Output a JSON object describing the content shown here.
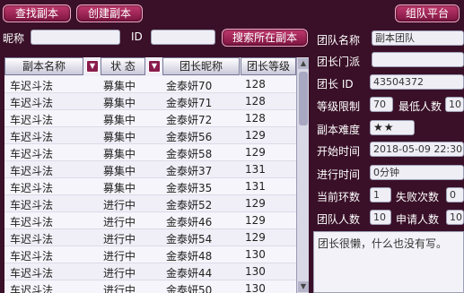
{
  "top_buttons": {
    "search_dungeon": "查找副本",
    "create_dungeon": "创建副本",
    "team_platform": "组队平台"
  },
  "search": {
    "nickname_label": "昵称",
    "nickname_value": "",
    "id_label": "ID",
    "id_value": "",
    "search_button": "搜索所在副本"
  },
  "table": {
    "headers": [
      "副本名称",
      "状 态",
      "团长昵称",
      "团长等级"
    ],
    "rows": [
      [
        "车迟斗法",
        "募集中",
        "金泰妍70",
        "128"
      ],
      [
        "车迟斗法",
        "募集中",
        "金泰妍71",
        "128"
      ],
      [
        "车迟斗法",
        "募集中",
        "金泰妍72",
        "128"
      ],
      [
        "车迟斗法",
        "募集中",
        "金泰妍56",
        "129"
      ],
      [
        "车迟斗法",
        "募集中",
        "金泰妍58",
        "129"
      ],
      [
        "车迟斗法",
        "募集中",
        "金泰妍37",
        "131"
      ],
      [
        "车迟斗法",
        "募集中",
        "金泰妍35",
        "131"
      ],
      [
        "车迟斗法",
        "进行中",
        "金泰妍52",
        "129"
      ],
      [
        "车迟斗法",
        "进行中",
        "金泰妍46",
        "129"
      ],
      [
        "车迟斗法",
        "进行中",
        "金泰妍54",
        "129"
      ],
      [
        "车迟斗法",
        "进行中",
        "金泰妍48",
        "130"
      ],
      [
        "车迟斗法",
        "进行中",
        "金泰妍44",
        "130"
      ],
      [
        "车迟斗法",
        "进行中",
        "金泰妍50",
        "130"
      ]
    ]
  },
  "detail": {
    "team_name_label": "团队名称",
    "team_name_value": "副本团队",
    "leader_sect_label": "团长门派",
    "leader_sect_value": "",
    "leader_id_label": "团长 ID",
    "leader_id_value": "43504372",
    "level_limit_label": "等级限制",
    "level_limit_value": "70",
    "min_players_label": "最低人数",
    "min_players_value": "10",
    "difficulty_label": "副本难度",
    "difficulty_value": "★★",
    "start_time_label": "开始时间",
    "start_time_value": "2018-05-09 22:30",
    "elapsed_label": "进行时间",
    "elapsed_value": "0分钟",
    "current_round_label": "当前环数",
    "current_round_value": "1",
    "fail_count_label": "失败次数",
    "fail_count_value": "0",
    "team_size_label": "团队人数",
    "team_size_value": "10",
    "applicants_label": "申请人数",
    "applicants_value": "10",
    "leader_note": "团长很懒，什么也没有写。"
  }
}
